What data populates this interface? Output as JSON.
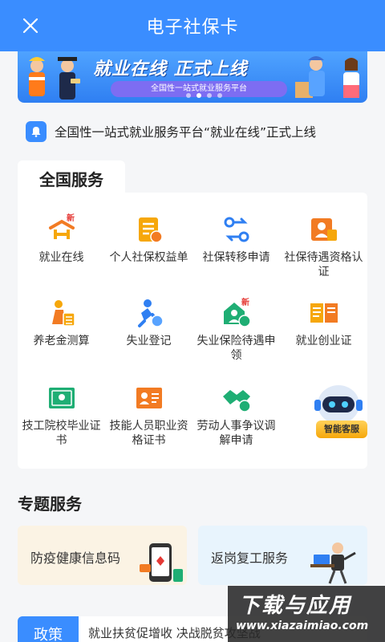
{
  "header": {
    "title": "电子社保卡"
  },
  "banner": {
    "main_text": "就业在线  正式上线",
    "sub_text": "全国性一站式就业服务平台",
    "slides": 4,
    "active_slide": 2
  },
  "notice": {
    "text": "全国性一站式就业服务平台“就业在线”正式上线"
  },
  "national": {
    "title": "全国服务",
    "items": [
      {
        "label": "就业在线",
        "icon": "job-online-icon",
        "badge": "新"
      },
      {
        "label": "个人社保权益单",
        "icon": "rights-statement-icon"
      },
      {
        "label": "社保转移申请",
        "icon": "transfer-icon"
      },
      {
        "label": "社保待遇资格认证",
        "icon": "benefit-certification-icon"
      },
      {
        "label": "养老金测算",
        "icon": "pension-calculator-icon"
      },
      {
        "label": "失业登记",
        "icon": "unemployment-registration-icon"
      },
      {
        "label": "失业保险待遇申领",
        "icon": "unemployment-insurance-icon",
        "badge": "新"
      },
      {
        "label": "就业创业证",
        "icon": "entrepreneurship-card-icon"
      },
      {
        "label": "技工院校毕业证书",
        "icon": "technical-diploma-icon"
      },
      {
        "label": "技能人员职业资格证书",
        "icon": "skill-certificate-icon"
      },
      {
        "label": "劳动人事争议调解申请",
        "icon": "mediation-icon"
      }
    ],
    "chatbot_label": "智能客服"
  },
  "topics": {
    "title": "专题服务",
    "items": [
      {
        "label": "防疫健康信息码"
      },
      {
        "label": "返岗复工服务"
      }
    ]
  },
  "policy": {
    "tag": "政策",
    "text": "就业扶贫促增收 决战脱贫攻坚战"
  },
  "watermark": {
    "big": "下载与应用",
    "small": "www.xiazaimiao.com"
  },
  "colors": {
    "primary": "#3a8dff",
    "orange": "#f27b23",
    "green": "#1fae74",
    "yellow": "#f6a70b",
    "blue_icon": "#2f7ff2"
  }
}
